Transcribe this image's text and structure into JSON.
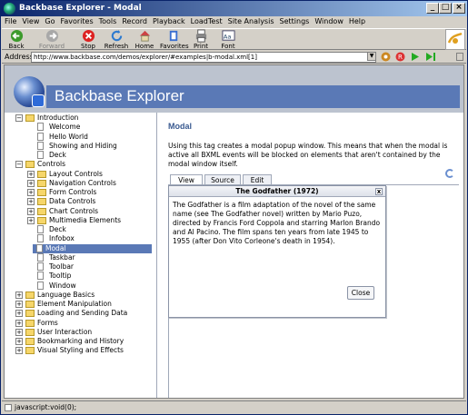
{
  "window": {
    "title": "Backbase Explorer - Modal"
  },
  "menu": [
    "File",
    "View",
    "Go",
    "Favorites",
    "Tools",
    "Record",
    "Playback",
    "LoadTest",
    "Site Analysis",
    "Settings",
    "Window",
    "Help"
  ],
  "toolbar": {
    "back": "Back",
    "forward": "Forward",
    "stop": "Stop",
    "refresh": "Refresh",
    "home": "Home",
    "favorites": "Favorites",
    "print": "Print",
    "font": "Font"
  },
  "address": {
    "label": "Address",
    "url": "http://www.backbase.com/demos/explorer/#examples|b-modal.xml[1]"
  },
  "app": {
    "title": "Backbase Explorer"
  },
  "tree": [
    {
      "label": "Introduction",
      "type": "folder",
      "level": 0,
      "expander": "−"
    },
    {
      "label": "Welcome",
      "type": "doc",
      "level": 1
    },
    {
      "label": "Hello World",
      "type": "doc",
      "level": 1
    },
    {
      "label": "Showing and Hiding",
      "type": "doc",
      "level": 1
    },
    {
      "label": "Deck",
      "type": "doc",
      "level": 1
    },
    {
      "label": "Controls",
      "type": "folder",
      "level": 0,
      "expander": "−"
    },
    {
      "label": "Layout Controls",
      "type": "folder",
      "level": 1,
      "expander": "+"
    },
    {
      "label": "Navigation Controls",
      "type": "folder",
      "level": 1,
      "expander": "+"
    },
    {
      "label": "Form Controls",
      "type": "folder",
      "level": 1,
      "expander": "+"
    },
    {
      "label": "Data Controls",
      "type": "folder",
      "level": 1,
      "expander": "+"
    },
    {
      "label": "Chart Controls",
      "type": "folder",
      "level": 1,
      "expander": "+"
    },
    {
      "label": "Multimedia Elements",
      "type": "folder",
      "level": 1,
      "expander": "+"
    },
    {
      "label": "Deck",
      "type": "doc",
      "level": 1
    },
    {
      "label": "Infobox",
      "type": "doc",
      "level": 1
    },
    {
      "label": "Modal",
      "type": "doc",
      "level": 1,
      "selected": true
    },
    {
      "label": "Taskbar",
      "type": "doc",
      "level": 1
    },
    {
      "label": "Toolbar",
      "type": "doc",
      "level": 1
    },
    {
      "label": "Tooltip",
      "type": "doc",
      "level": 1
    },
    {
      "label": "Window",
      "type": "doc",
      "level": 1
    },
    {
      "label": "Language Basics",
      "type": "folder",
      "level": 0,
      "expander": "+"
    },
    {
      "label": "Element Manipulation",
      "type": "folder",
      "level": 0,
      "expander": "+"
    },
    {
      "label": "Loading and Sending Data",
      "type": "folder",
      "level": 0,
      "expander": "+"
    },
    {
      "label": "Forms",
      "type": "folder",
      "level": 0,
      "expander": "+"
    },
    {
      "label": "User Interaction",
      "type": "folder",
      "level": 0,
      "expander": "+"
    },
    {
      "label": "Bookmarking and History",
      "type": "folder",
      "level": 0,
      "expander": "+"
    },
    {
      "label": "Visual Styling and Effects",
      "type": "folder",
      "level": 0,
      "expander": "+"
    }
  ],
  "main": {
    "title": "Modal",
    "description": "Using this tag creates a modal popup window. This means that when the modal is active all BXML events will be blocked on elements that aren't contained by the modal window itself.",
    "tabs": [
      "View",
      "Source",
      "Edit"
    ]
  },
  "modal": {
    "title": "The Godfather (1972)",
    "close_x": "x",
    "body": "The Godfather is a film adaptation of the novel of the same name (see The Godfather novel) written by Mario Puzo, directed by Francis Ford Coppola and starring Marlon Brando and Al Pacino. The film spans ten years from late 1945 to 1955 (after Don Vito Corleone's death in 1954).",
    "close_button": "Close"
  },
  "status": {
    "text": "javascript:void(0);"
  }
}
